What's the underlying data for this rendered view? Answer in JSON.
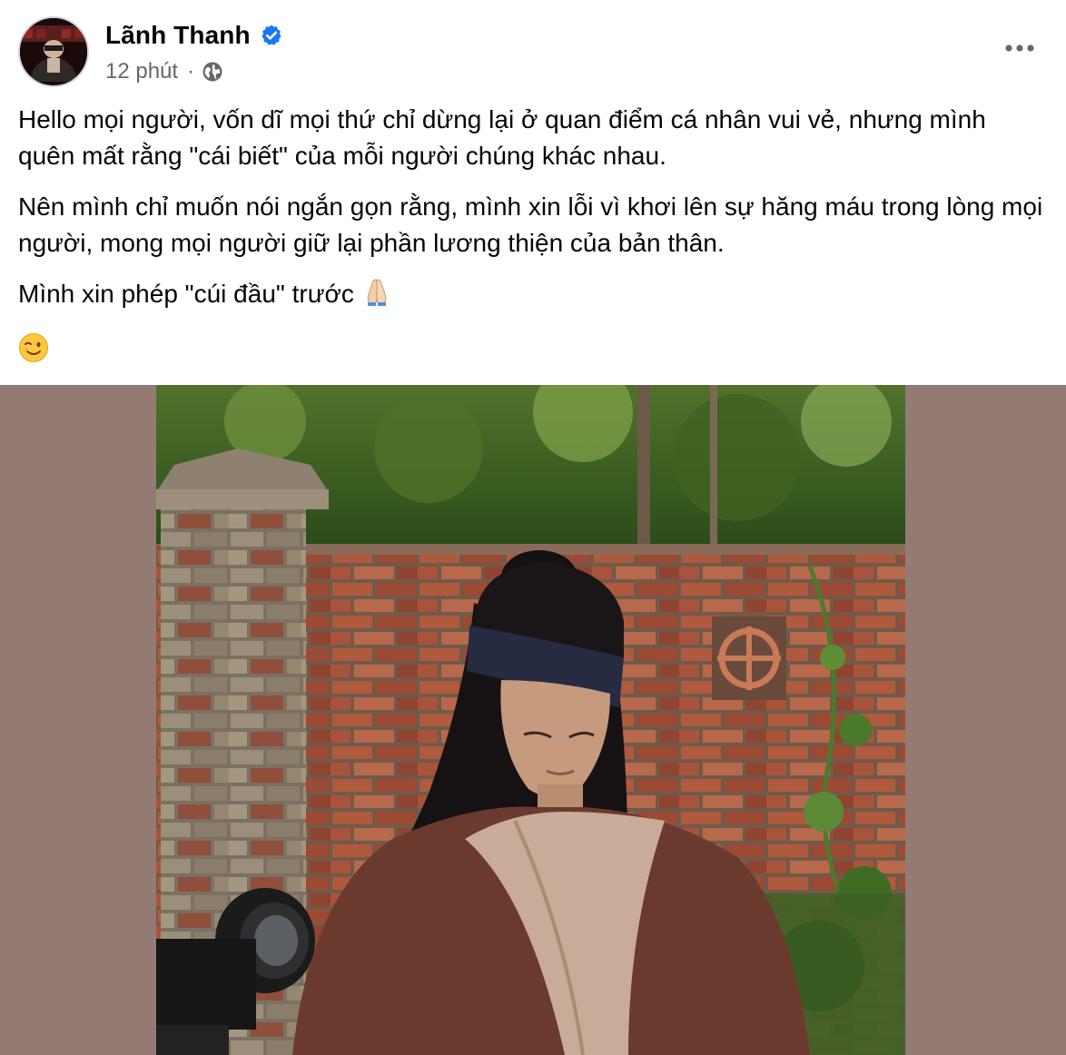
{
  "post": {
    "author": {
      "name": "Lãnh Thanh",
      "verified": true,
      "avatar_icon": "avatar-photo"
    },
    "timestamp": "12 phút",
    "meta_separator": "·",
    "audience_icon": "globe-icon",
    "more_icon": "more-options-icon",
    "paragraphs": [
      "Hello mọi người, vốn dĩ mọi thứ chỉ dừng lại ở quan điểm cá nhân vui vẻ, nhưng mình quên mất rằng \"cái biết\" của mỗi người chúng khác nhau.",
      "Nên mình chỉ muốn nói ngắn gọn rằng, mình xin lỗi vì khơi lên sự hăng máu trong lòng mọi người, mong mọi người giữ lại phần lương thiện của bản thân.",
      "Mình xin phép \"cúi đầu\" trước"
    ],
    "emojis": {
      "folded_hands": "🙏",
      "wink": "😉"
    },
    "photo_icon": "post-photo"
  },
  "colors": {
    "text_primary": "#050505",
    "text_secondary": "#65676b",
    "verified_blue": "#1877f2",
    "photo_backdrop": "#937b73"
  }
}
